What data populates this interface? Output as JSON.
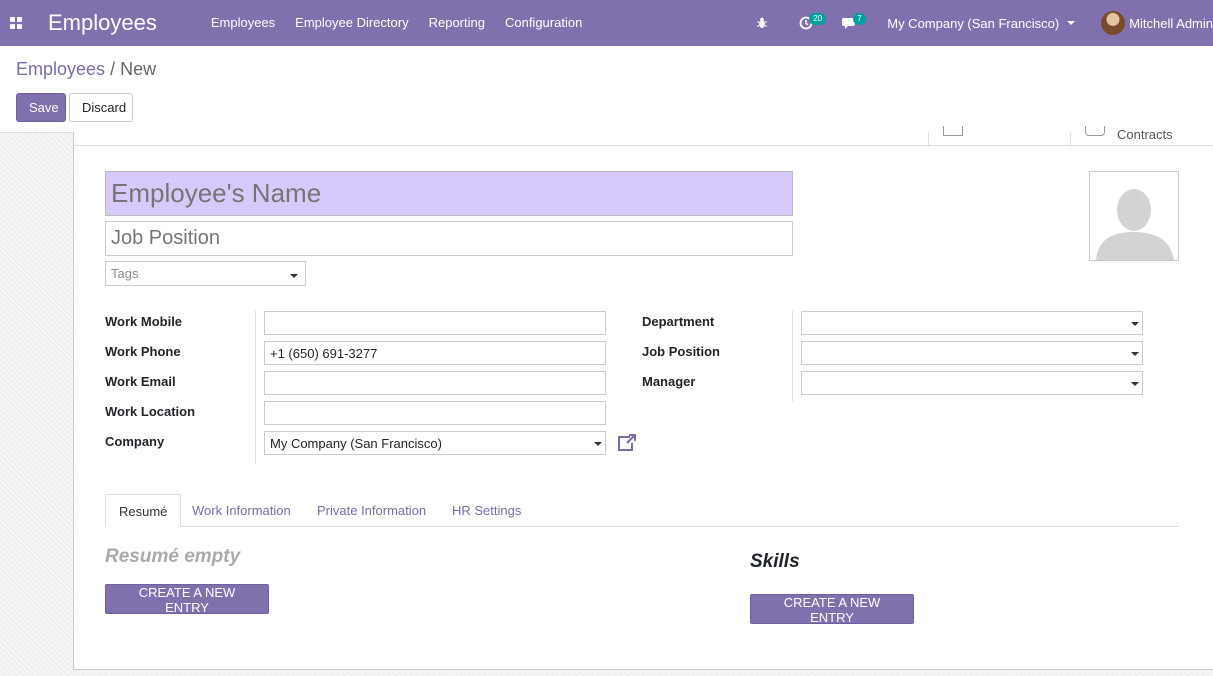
{
  "navbar": {
    "brand": "Employees",
    "menu": [
      "Employees",
      "Employee Directory",
      "Reporting",
      "Configuration"
    ],
    "activity_count": "20",
    "message_count": "7",
    "company": "My Company (San Francisco)",
    "user": "Mitchell Admin"
  },
  "breadcrumb": {
    "parent": "Employees",
    "separator": "/",
    "current": "New"
  },
  "buttons": {
    "save": "Save",
    "discard": "Discard"
  },
  "stat_buttons": {
    "contracts": "Contracts"
  },
  "form": {
    "name_placeholder": "Employee's Name",
    "job_placeholder": "Job Position",
    "tags_placeholder": "Tags",
    "labels": {
      "work_mobile": "Work Mobile",
      "work_phone": "Work Phone",
      "work_email": "Work Email",
      "work_location": "Work Location",
      "company": "Company",
      "department": "Department",
      "job_position": "Job Position",
      "manager": "Manager"
    },
    "values": {
      "work_mobile": "",
      "work_phone": "+1 (650) 691-3277",
      "work_email": "",
      "work_location": "",
      "company": "My Company (San Francisco)",
      "department": "",
      "job_position": "",
      "manager": ""
    }
  },
  "tabs": [
    "Resumé",
    "Work Information",
    "Private Information",
    "HR Settings"
  ],
  "resume": {
    "empty_text": "Resumé empty",
    "create_label": "CREATE A NEW ENTRY"
  },
  "skills": {
    "title": "Skills",
    "create_label": "CREATE A NEW ENTRY"
  },
  "colors": {
    "brand": "#8070AD",
    "name_field_bg": "#D7C9F9",
    "badge": "#00A09D"
  }
}
